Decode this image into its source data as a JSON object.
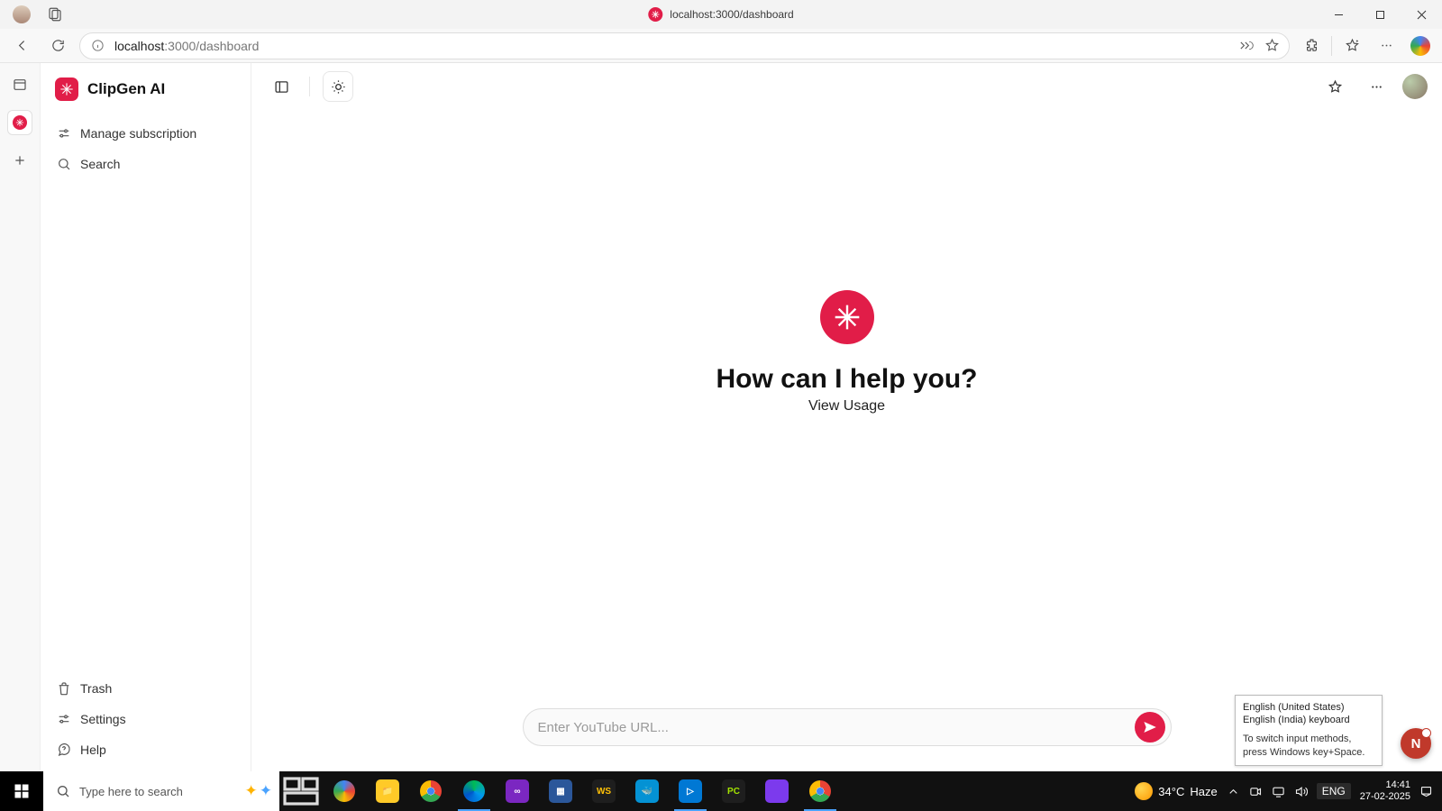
{
  "browser": {
    "title": "localhost:3000/dashboard",
    "url_host": "localhost",
    "url_port_path": ":3000/dashboard"
  },
  "app": {
    "name": "ClipGen AI"
  },
  "sidebar": {
    "top": [
      {
        "label": "Manage subscription"
      },
      {
        "label": "Search"
      }
    ],
    "bottom": [
      {
        "label": "Trash"
      },
      {
        "label": "Settings"
      },
      {
        "label": "Help"
      }
    ]
  },
  "main": {
    "heading": "How can I help you?",
    "subheading": "View Usage",
    "input_placeholder": "Enter YouTube URL..."
  },
  "lang_tooltip": {
    "line1": "English (United States)",
    "line2": "English (India) keyboard",
    "line3": "To switch input methods, press Windows key+Space."
  },
  "notification": {
    "letter": "N"
  },
  "taskbar": {
    "search_placeholder": "Type here to search",
    "weather_temp": "34°C",
    "weather_cond": "Haze",
    "lang": "ENG",
    "time": "14:41",
    "date": "27-02-2025"
  },
  "colors": {
    "accent": "#e11d48"
  }
}
